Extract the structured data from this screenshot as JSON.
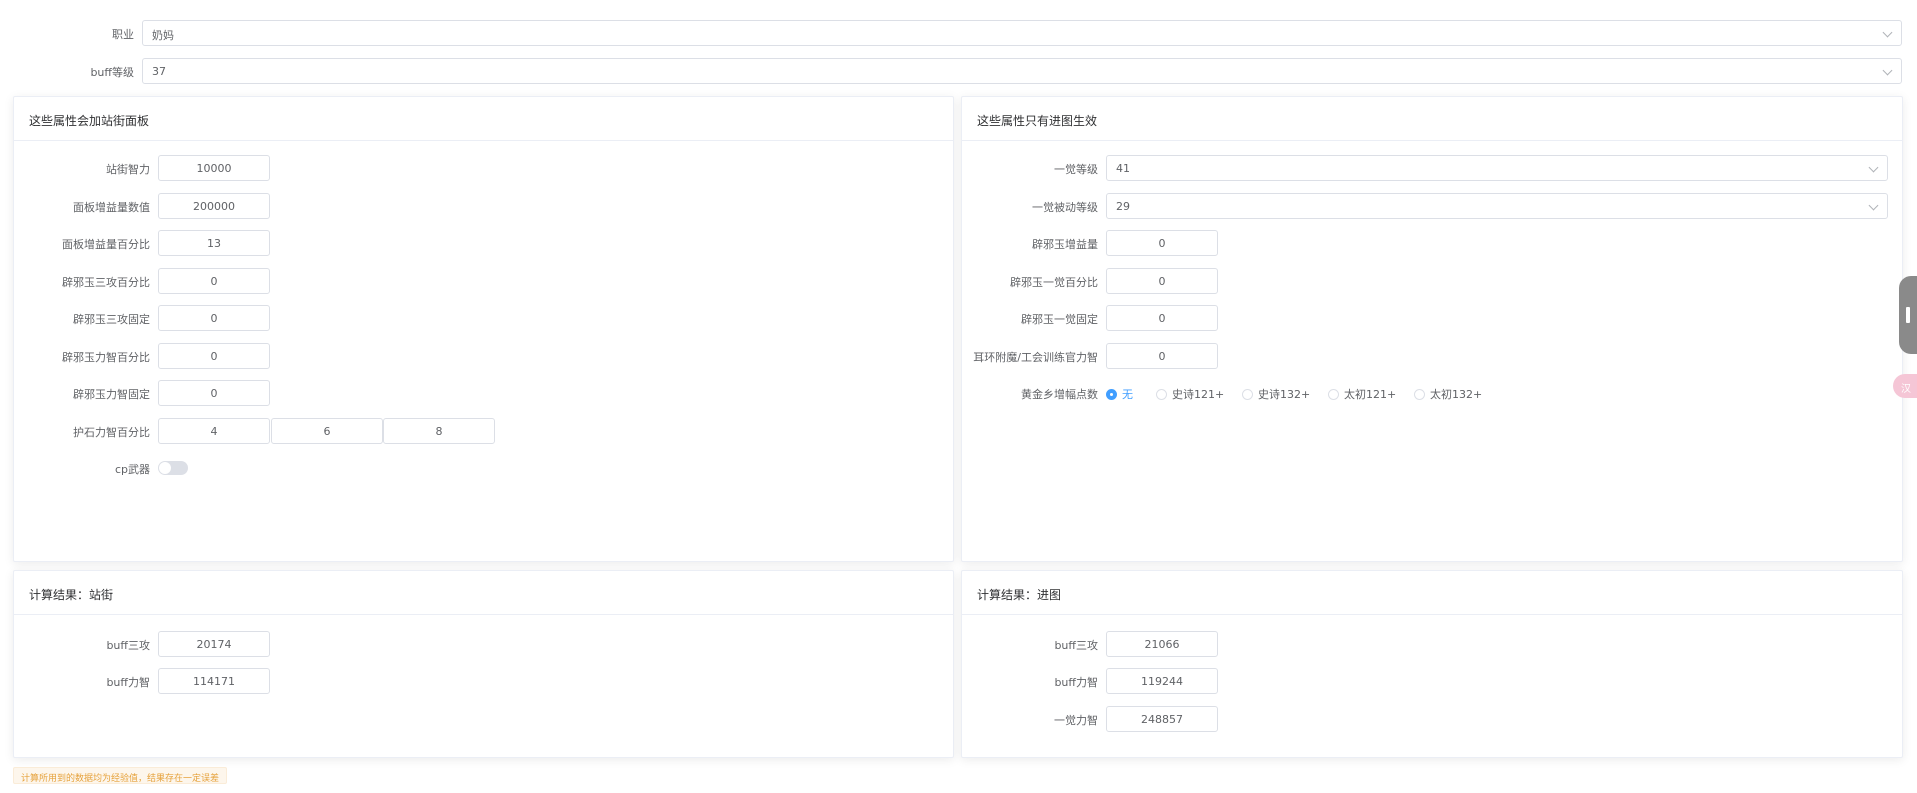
{
  "top": {
    "job_label": "职业",
    "job_value": "奶妈",
    "buff_level_label": "buff等级",
    "buff_level_value": "37"
  },
  "panel_street": {
    "title": "这些属性会加站街面板",
    "int_label": "站街智力",
    "int_value": "10000",
    "panel_gain_label": "面板增益量数值",
    "panel_gain_value": "200000",
    "panel_gain_pct_label": "面板增益量百分比",
    "panel_gain_pct_value": "13",
    "jade_triple_pct_label": "辟邪玉三攻百分比",
    "jade_triple_pct_value": "0",
    "jade_triple_fixed_label": "辟邪玉三攻固定",
    "jade_triple_fixed_value": "0",
    "jade_stat_pct_label": "辟邪玉力智百分比",
    "jade_stat_pct_value": "0",
    "jade_stat_fixed_label": "辟邪玉力智固定",
    "jade_stat_fixed_value": "0",
    "stone_label": "护石力智百分比",
    "stone_values": [
      "4",
      "6",
      "8"
    ],
    "cp_label": "cp武器"
  },
  "panel_dungeon": {
    "title": "这些属性只有进图生效",
    "awaken_level_label": "一觉等级",
    "awaken_level_value": "41",
    "awaken_passive_label": "一觉被动等级",
    "awaken_passive_value": "29",
    "jade_gain_label": "辟邪玉增益量",
    "jade_gain_value": "0",
    "jade_awaken_pct_label": "辟邪玉一觉百分比",
    "jade_awaken_pct_value": "0",
    "jade_awaken_fixed_label": "辟邪玉一觉固定",
    "jade_awaken_fixed_value": "0",
    "earring_label": "耳环附魔/工会训练官力智",
    "earring_value": "0",
    "gold_label": "黄金乡增幅点数",
    "gold_options": [
      "无",
      "史诗121+",
      "史诗132+",
      "太初121+",
      "太初132+"
    ],
    "gold_selected": "无"
  },
  "result_street": {
    "title": "计算结果：站街",
    "triple_label": "buff三攻",
    "triple_value": "20174",
    "stat_label": "buff力智",
    "stat_value": "114171"
  },
  "result_dungeon": {
    "title": "计算结果：进图",
    "triple_label": "buff三攻",
    "triple_value": "21066",
    "stat_label": "buff力智",
    "stat_value": "119244",
    "awaken_label": "一觉力智",
    "awaken_value": "248857"
  },
  "footer_tip": "计算所用到的数据均为经验值，结果存在一定误差",
  "side_pink_text": "汉",
  "colors": {
    "primary": "#409eff",
    "border": "#dcdfe6",
    "warning": "#e6a23c",
    "warning_bg": "#fdf6ec"
  },
  "icons": [
    "chevron-down-icon",
    "radio-icon",
    "toggle-switch",
    "side-drawer-handle-icon"
  ]
}
